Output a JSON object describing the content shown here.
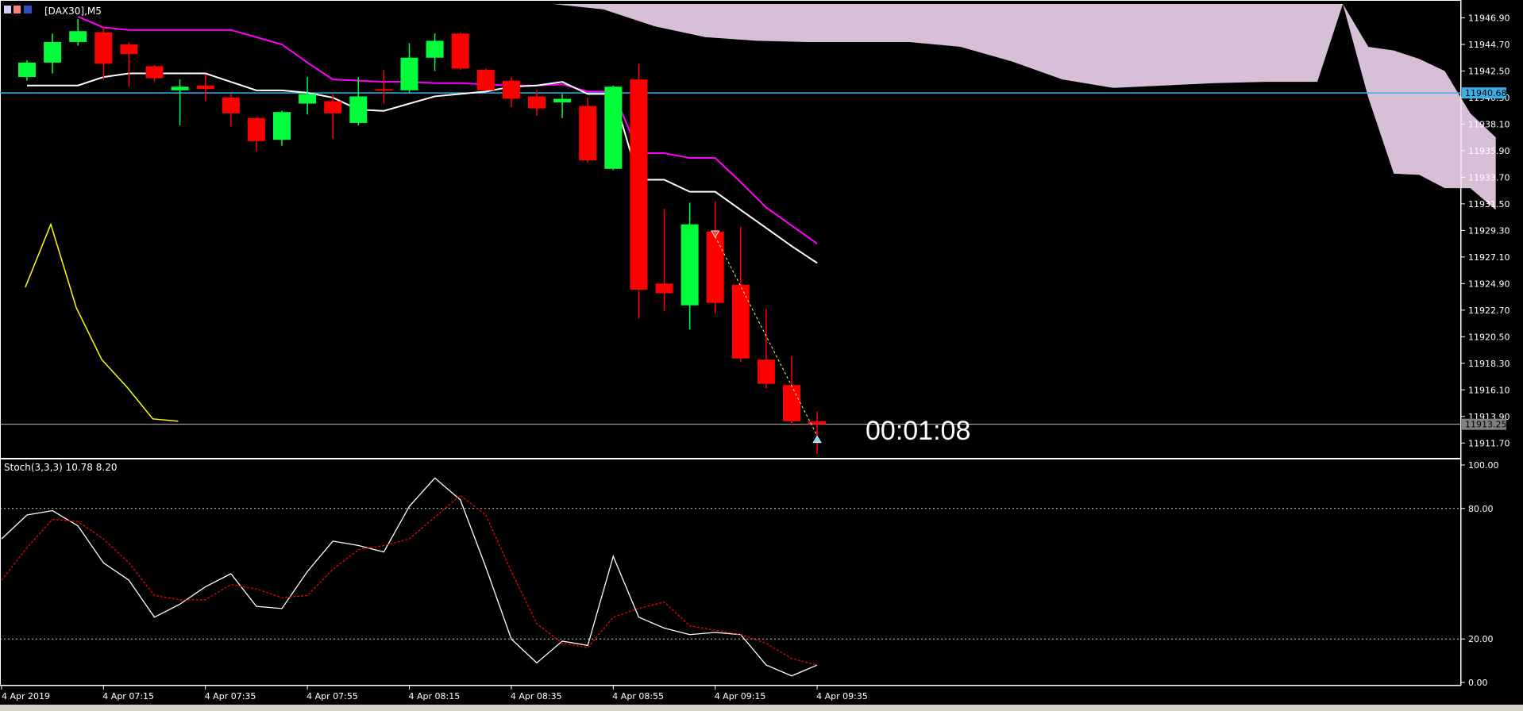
{
  "window": {
    "symbol_label": "[DAX30],M5",
    "countdown": "00:01:08"
  },
  "colors": {
    "background": "#000000",
    "bull": "#00ff3a",
    "bear": "#ff0000",
    "wick_bull": "#00ff3a",
    "wick_bear": "#ff0000",
    "ma_fast": "#ffffff",
    "ma_slow": "#ff00ff",
    "cloud": "#d8bfd8",
    "stoch_main": "#ffffff",
    "stoch_signal": "#ff0000",
    "hline_blue": "#3ab0e8",
    "hline_bid": "#c0c0c0",
    "osc_left": "#ffff00",
    "axis_text": "#ffffff",
    "grid_dot": "#ffffff"
  },
  "chart_data": [
    {
      "type": "candlestick",
      "timeframe": "M5",
      "y_ticks": [
        "11946.90",
        "11944.70",
        "11942.50",
        "11940.30",
        "11938.10",
        "11935.90",
        "11933.70",
        "11931.50",
        "11929.30",
        "11927.10",
        "11924.90",
        "11922.70",
        "11920.50",
        "11918.30",
        "11916.10",
        "11913.90",
        "11911.70"
      ],
      "ylim": [
        11910.6,
        11948.05
      ],
      "price_labels": {
        "blue_line": {
          "value": 11940.68,
          "text": "11940.68"
        },
        "bid_line": {
          "value": 11913.25,
          "text": "11913.25"
        }
      },
      "candles": [
        {
          "o": 11942.0,
          "h": 11943.4,
          "l": 11941.7,
          "c": 11943.2
        },
        {
          "o": 11943.2,
          "h": 11945.6,
          "l": 11942.3,
          "c": 11944.9
        },
        {
          "o": 11944.9,
          "h": 11946.8,
          "l": 11944.6,
          "c": 11945.8
        },
        {
          "o": 11945.7,
          "h": 11946.2,
          "l": 11941.8,
          "c": 11943.1
        },
        {
          "o": 11944.7,
          "h": 11944.9,
          "l": 11941.2,
          "c": 11943.9
        },
        {
          "o": 11942.9,
          "h": 11943.0,
          "l": 11941.6,
          "c": 11941.9
        },
        {
          "o": 11940.9,
          "h": 11941.8,
          "l": 11938.0,
          "c": 11941.2
        },
        {
          "o": 11941.3,
          "h": 11942.2,
          "l": 11940.0,
          "c": 11941.0
        },
        {
          "o": 11940.3,
          "h": 11940.6,
          "l": 11937.9,
          "c": 11939.0
        },
        {
          "o": 11938.6,
          "h": 11938.7,
          "l": 11935.8,
          "c": 11936.7
        },
        {
          "o": 11936.8,
          "h": 11939.2,
          "l": 11936.3,
          "c": 11939.1
        },
        {
          "o": 11939.8,
          "h": 11942.0,
          "l": 11938.9,
          "c": 11940.6
        },
        {
          "o": 11940.0,
          "h": 11940.6,
          "l": 11936.9,
          "c": 11939.0
        },
        {
          "o": 11938.2,
          "h": 11942.0,
          "l": 11938.0,
          "c": 11940.4
        },
        {
          "o": 11941.0,
          "h": 11942.6,
          "l": 11939.8,
          "c": 11940.9
        },
        {
          "o": 11940.9,
          "h": 11944.8,
          "l": 11940.7,
          "c": 11943.6
        },
        {
          "o": 11943.6,
          "h": 11945.6,
          "l": 11942.5,
          "c": 11945.0
        },
        {
          "o": 11945.6,
          "h": 11945.7,
          "l": 11942.6,
          "c": 11942.7
        },
        {
          "o": 11942.6,
          "h": 11942.7,
          "l": 11940.9,
          "c": 11940.9
        },
        {
          "o": 11941.7,
          "h": 11942.0,
          "l": 11939.5,
          "c": 11940.2
        },
        {
          "o": 11940.4,
          "h": 11940.9,
          "l": 11938.8,
          "c": 11939.4
        },
        {
          "o": 11939.9,
          "h": 11940.6,
          "l": 11938.6,
          "c": 11940.2
        },
        {
          "o": 11939.6,
          "h": 11940.3,
          "l": 11934.9,
          "c": 11935.1
        },
        {
          "o": 11934.4,
          "h": 11941.3,
          "l": 11934.3,
          "c": 11941.2
        },
        {
          "o": 11941.8,
          "h": 11943.1,
          "l": 11922.0,
          "c": 11924.4
        },
        {
          "o": 11924.9,
          "h": 11931.1,
          "l": 11922.6,
          "c": 11924.1
        },
        {
          "o": 11923.1,
          "h": 11931.6,
          "l": 11921.1,
          "c": 11929.8
        },
        {
          "o": 11929.2,
          "h": 11931.7,
          "l": 11922.4,
          "c": 11923.3
        },
        {
          "o": 11924.8,
          "h": 11929.6,
          "l": 11918.4,
          "c": 11918.7
        },
        {
          "o": 11918.6,
          "h": 11922.8,
          "l": 11916.2,
          "c": 11916.6
        },
        {
          "o": 11916.5,
          "h": 11918.9,
          "l": 11913.2,
          "c": 11913.5
        },
        {
          "o": 11913.5,
          "h": 11914.3,
          "l": 11910.8,
          "c": 11913.25
        }
      ],
      "ma_white": [
        11941.3,
        11941.3,
        11941.3,
        11942.0,
        11942.3,
        11942.3,
        11942.3,
        11942.3,
        11941.6,
        11940.9,
        11940.9,
        11940.7,
        11940.3,
        11939.3,
        11939.2,
        11939.8,
        11940.4,
        11940.6,
        11940.8,
        11941.2,
        11941.3,
        11941.6,
        11940.6,
        11940.6,
        11933.5,
        11933.5,
        11932.5,
        11932.5,
        11931.0,
        11929.5,
        11928.0,
        11926.6
      ],
      "ma_magenta": [
        null,
        null,
        11947.0,
        11946.1,
        11945.9,
        11945.9,
        11945.9,
        11945.9,
        11945.9,
        11945.3,
        11944.7,
        11943.2,
        11941.8,
        11941.7,
        11941.6,
        11941.6,
        11941.5,
        11941.5,
        11941.4,
        11941.3,
        11941.3,
        11941.4,
        11940.8,
        11940.8,
        11935.7,
        11935.7,
        11935.3,
        11935.3,
        11933.3,
        11931.2,
        11929.7,
        11928.2
      ],
      "cloud_top": [
        [
          20,
          11948.05
        ],
        [
          22,
          11947.6
        ],
        [
          24,
          11946.2
        ],
        [
          26,
          11945.3
        ],
        [
          28,
          11945.0
        ],
        [
          30,
          11944.9
        ],
        [
          32,
          11944.9
        ],
        [
          34,
          11944.9
        ],
        [
          36,
          11944.5
        ],
        [
          38,
          11943.3
        ],
        [
          40,
          11941.8
        ],
        [
          42,
          11941.1
        ],
        [
          44,
          11941.3
        ],
        [
          46,
          11941.5
        ],
        [
          48,
          11941.6
        ],
        [
          50,
          11941.6
        ],
        [
          51,
          11948.05
        ],
        [
          52,
          11944.5
        ],
        [
          53,
          11944.2
        ],
        [
          54,
          11943.5
        ],
        [
          55,
          11942.5
        ],
        [
          56,
          11939.0
        ],
        [
          57,
          11937.0
        ]
      ],
      "cloud_bottom": [
        [
          20,
          11948.05
        ],
        [
          50,
          11948.05
        ],
        [
          51,
          11948.05
        ],
        [
          52,
          11940.3
        ],
        [
          53,
          11934.0
        ],
        [
          54,
          11933.9
        ],
        [
          55,
          11932.8
        ],
        [
          56,
          11932.8
        ],
        [
          57,
          11931.0
        ]
      ],
      "left_oscillator": [
        [
          -1,
          11924.6
        ],
        [
          0,
          11929.8
        ],
        [
          1,
          11922.9
        ],
        [
          2,
          11918.6
        ],
        [
          3,
          11916.3
        ],
        [
          4,
          11913.7
        ],
        [
          5,
          11913.5
        ]
      ],
      "dotted_projection": [
        [
          27,
          11928.8
        ],
        [
          31,
          11912.3
        ]
      ],
      "arrows": [
        {
          "bar": 27,
          "price": 11929.0,
          "color": "#ff4040",
          "dir": "down"
        },
        {
          "bar": 31,
          "price": 11912.0,
          "color": "#7fd6ff",
          "dir": "up"
        }
      ],
      "x_labels": [
        "4 Apr 2019",
        "4 Apr 07:15",
        "4 Apr 07:35",
        "4 Apr 07:55",
        "4 Apr 08:15",
        "4 Apr 08:35",
        "4 Apr 08:55",
        "4 Apr 09:15",
        "4 Apr 09:35"
      ],
      "x_label_bars": [
        -1,
        3,
        7,
        11,
        15,
        19,
        23,
        27,
        31
      ]
    },
    {
      "type": "line",
      "title": "Stoch(3,3,3) 10.78 8.20",
      "y_ticks": [
        "100.00",
        "80.00",
        "20.00",
        "0.00"
      ],
      "levels": [
        80,
        20
      ],
      "ylim": [
        0,
        100
      ],
      "series": [
        {
          "name": "main",
          "values": [
            66,
            77,
            79,
            72,
            55,
            47,
            30,
            36,
            44,
            50,
            35,
            34,
            51,
            65,
            63,
            60,
            81,
            94,
            84,
            53,
            20,
            9,
            19,
            17,
            58,
            30,
            25,
            22,
            23,
            22,
            8,
            3,
            8
          ]
        },
        {
          "name": "signal",
          "values": [
            47,
            62,
            75,
            74,
            66,
            55,
            40,
            38,
            38,
            45,
            43,
            39,
            40,
            52,
            61,
            63,
            66,
            76,
            86,
            77,
            51,
            27,
            18,
            16,
            30,
            34,
            37,
            26,
            24,
            22,
            18,
            11,
            8
          ]
        }
      ],
      "x_start_bar": -1
    }
  ]
}
